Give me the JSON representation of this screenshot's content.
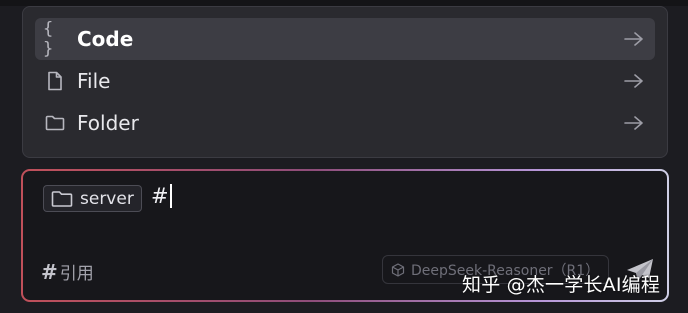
{
  "menu": {
    "items": [
      {
        "icon": "code-icon",
        "label": "Code",
        "active": true
      },
      {
        "icon": "file-icon",
        "label": "File",
        "active": false
      },
      {
        "icon": "folder-icon",
        "label": "Folder",
        "active": false
      }
    ]
  },
  "input": {
    "chip_label": "server",
    "typed_text": "#",
    "quote_hash": "#",
    "quote_label": "引用",
    "model_label": "DeepSeek-Reasoner（R1）"
  },
  "watermark": {
    "text": "知乎 @杰一学长AI编程"
  },
  "colors": {
    "background": "#1c1c21",
    "menu_bg": "#2a2a2f",
    "active_item_bg": "#3d3d44",
    "input_bg": "#17171b",
    "border_gradient_start": "#c0505a",
    "border_gradient_end": "#cfcfe6"
  }
}
